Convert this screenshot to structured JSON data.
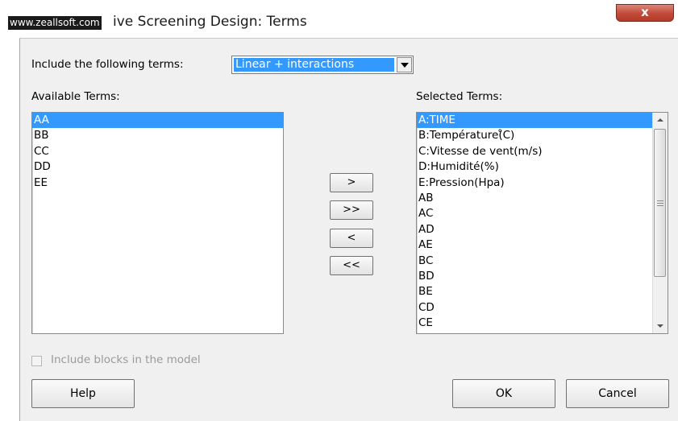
{
  "window": {
    "watermark": "www.zeallsoft.com",
    "title": "ive Screening Design: Terms",
    "close_label": "x"
  },
  "include_terms": {
    "label": "Include the following terms:",
    "selected": "Linear + interactions"
  },
  "available": {
    "label": "Available Terms:",
    "items": [
      "AA",
      "BB",
      "CC",
      "DD",
      "EE"
    ]
  },
  "selected": {
    "label": "Selected Terms:",
    "items": [
      "A:TIME",
      "B:Température(̊C)",
      "C:Vitesse de vent(m/s)",
      "D:Humidité(%)",
      "E:Pression(Hpa)",
      "AB",
      "AC",
      "AD",
      "AE",
      "BC",
      "BD",
      "BE",
      "CD",
      "CE"
    ]
  },
  "move_buttons": {
    "add": ">",
    "add_all": ">>",
    "remove": "<",
    "remove_all": "<<"
  },
  "blocks": {
    "label": "Include blocks in the model",
    "checked": false,
    "enabled": false
  },
  "buttons": {
    "help": "Help",
    "ok": "OK",
    "cancel": "Cancel"
  },
  "colors": {
    "selection": "#3399ff",
    "dialog_bg": "#f0f0f0",
    "close_button": "#c24a38"
  }
}
